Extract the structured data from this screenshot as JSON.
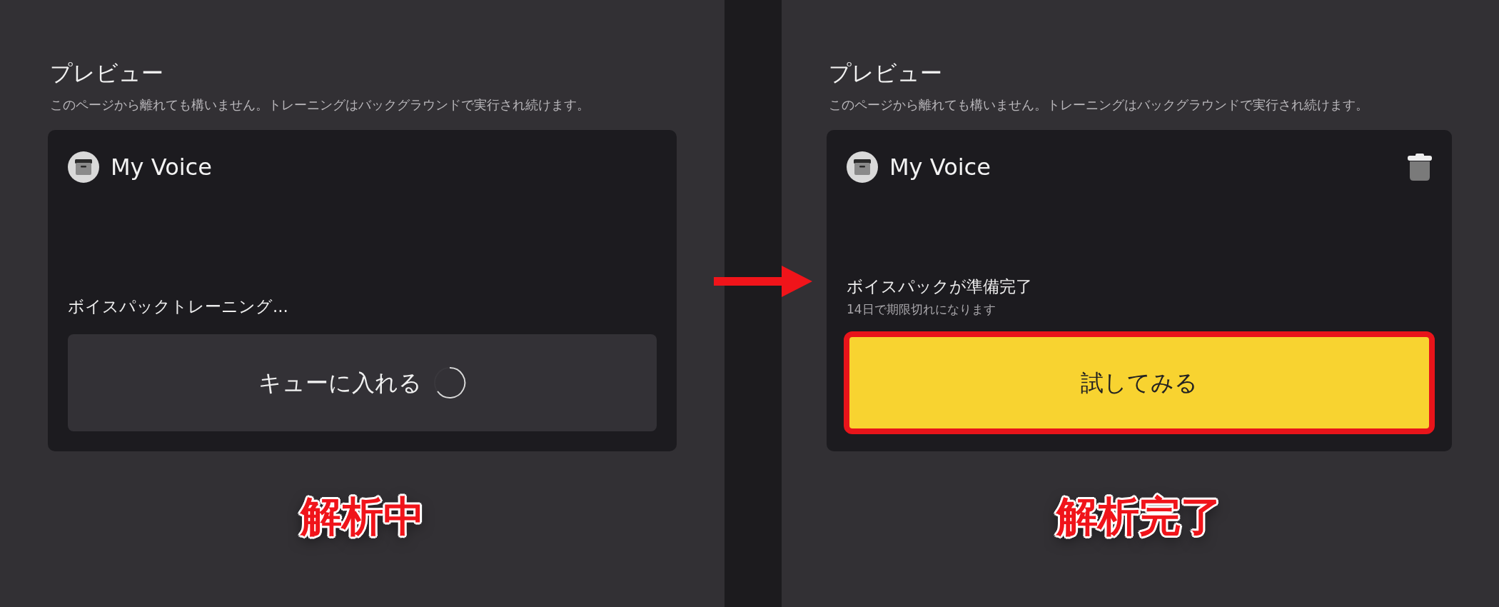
{
  "panels": [
    {
      "heading": "プレビュー",
      "subtitle": "このページから離れても構いません。トレーニングはバックグラウンドで実行され続けます。",
      "card": {
        "title": "My Voice",
        "delete_icon": false,
        "status": "ボイスパックトレーニング...",
        "button": {
          "label": "キューに入れる",
          "kind": "queued",
          "loading": true,
          "highlighted": false
        }
      },
      "caption": "解析中"
    },
    {
      "heading": "プレビュー",
      "subtitle": "このページから離れても構いません。トレーニングはバックグラウンドで実行され続けます。",
      "card": {
        "title": "My Voice",
        "delete_icon": true,
        "status": "ボイスパックが準備完了",
        "status_detail": "14日で期限切れになります",
        "button": {
          "label": "試してみる",
          "kind": "primary",
          "loading": false,
          "highlighted": true
        }
      },
      "caption": "解析完了"
    }
  ],
  "arrow_between_panels": true
}
